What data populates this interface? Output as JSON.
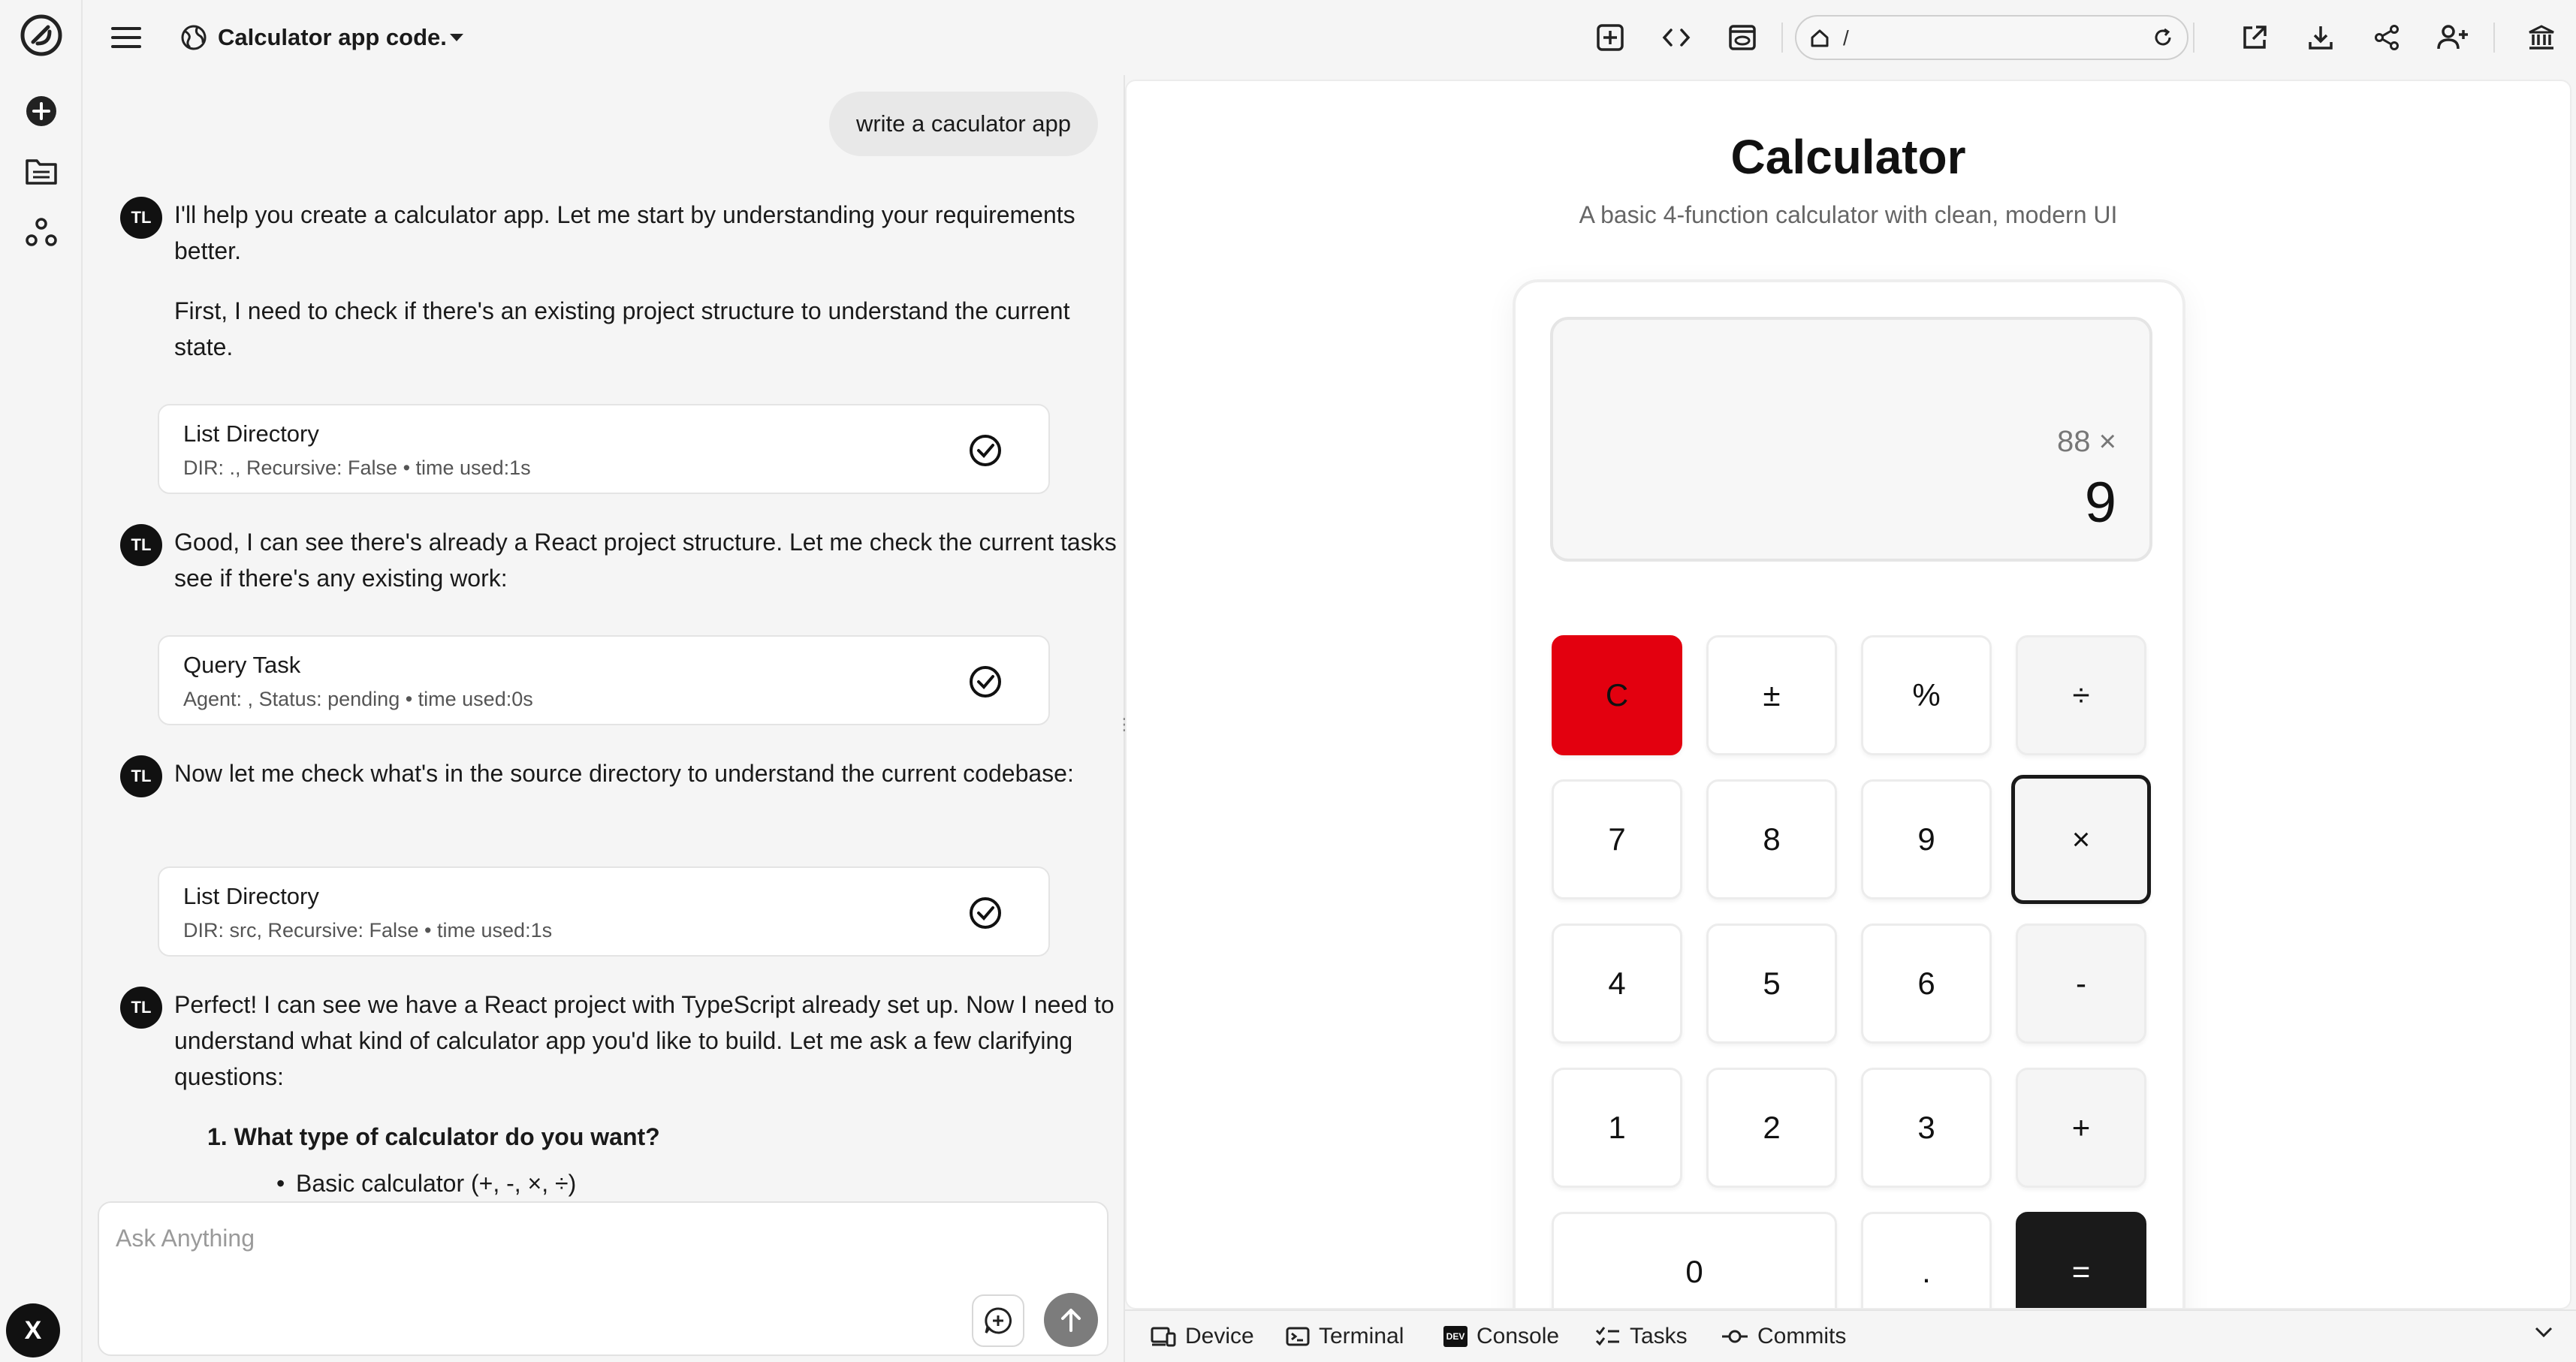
{
  "colors": {
    "clear_key": "#e3000f",
    "equals_key": "#1a1a1a",
    "avatar_bg": "#111111",
    "send_button": "#7c7c7c"
  },
  "rail": {
    "icons": [
      "app-logo-icon",
      "plus-circle-icon",
      "folder-icon",
      "nodes-icon"
    ],
    "user_initial": "X"
  },
  "topbar": {
    "project_title": "Calculator app code.",
    "url": "/",
    "icons": [
      "menu-icon",
      "globe-icon",
      "chevron-down-icon",
      "add-page-icon",
      "code-icon",
      "preview-icon",
      "home-icon",
      "refresh-icon",
      "open-external-icon",
      "download-icon",
      "share-icon",
      "add-user-icon",
      "bank-icon"
    ]
  },
  "chat": {
    "user_message": "write a caculator app",
    "assistant_initials": "TL",
    "messages": [
      "I'll help you create a calculator app. Let me start by understanding your requirements better.",
      "First, I need to check if there's an existing project structure to understand the current state.",
      "Good, I can see there's already a React project structure. Let me check the current tasks to see if there's any existing work:",
      "Now let me check what's in the source directory to understand the current codebase:",
      "Perfect! I can see we have a React project with TypeScript already set up. Now I need to understand what kind of calculator app you'd like to build. Let me ask a few clarifying questions:"
    ],
    "tools": [
      {
        "title": "List Directory",
        "detail": "DIR: ., Recursive: False • time used:1s"
      },
      {
        "title": "Query Task",
        "detail": "Agent: , Status: pending • time used:0s"
      },
      {
        "title": "List Directory",
        "detail": "DIR: src, Recursive: False • time used:1s"
      }
    ],
    "question_1": "1. What type of calculator do you want?",
    "bullet_1": "Basic calculator (+, -, ×, ÷)"
  },
  "composer": {
    "placeholder": "Ask Anything"
  },
  "preview": {
    "title": "Calculator",
    "subtitle": "A basic 4-function calculator with clean, modern UI",
    "display_expression": "88 ×",
    "display_value": "9",
    "keys": {
      "clear": "C",
      "plus_minus": "±",
      "percent": "%",
      "divide": "÷",
      "seven": "7",
      "eight": "8",
      "nine": "9",
      "multiply": "×",
      "four": "4",
      "five": "5",
      "six": "6",
      "minus": "-",
      "one": "1",
      "two": "2",
      "three": "3",
      "plus": "+",
      "zero": "0",
      "dot": ".",
      "equals": "="
    }
  },
  "bottombar": {
    "tabs": [
      "Device",
      "Terminal",
      "Console",
      "Tasks",
      "Commits"
    ],
    "console_badge": "DEV"
  }
}
